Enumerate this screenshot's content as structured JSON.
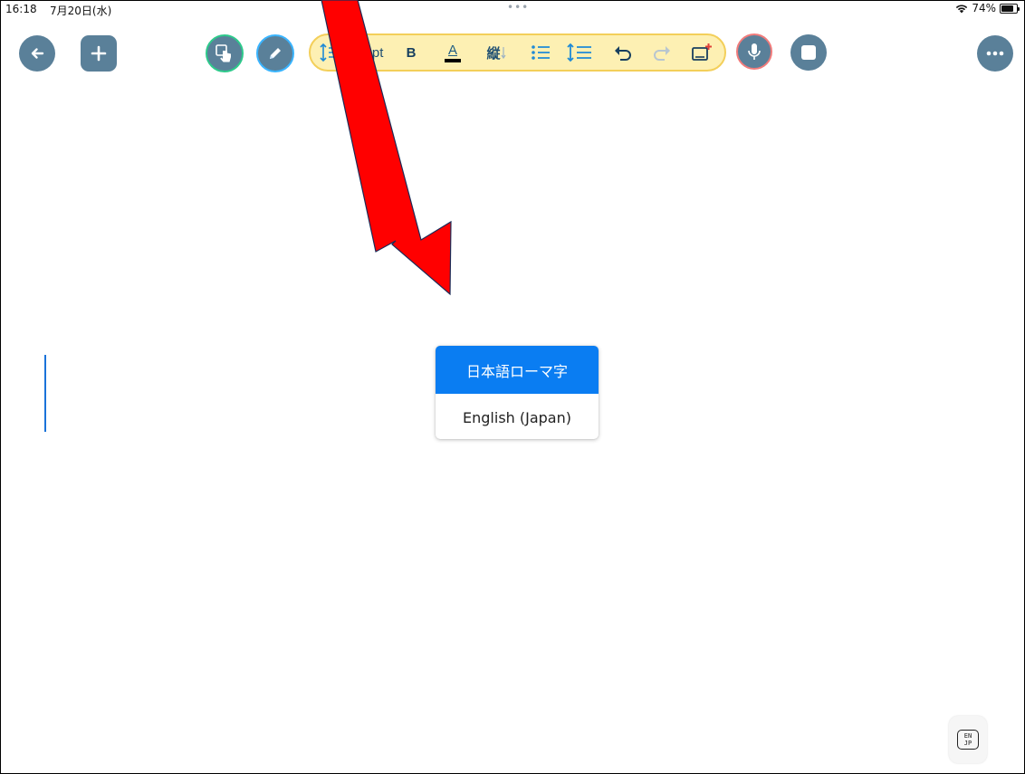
{
  "status_bar": {
    "time": "16:18",
    "date": "7月20日(水)",
    "dots": "•••",
    "battery_pct": "74%"
  },
  "toolbar": {
    "back_icon": "arrow-left-icon",
    "add_icon": "plus-icon",
    "touch_mode_icon": "hand-pointer-icon",
    "pen_mode_icon": "pencil-icon",
    "font_size": "0pt",
    "bold_label": "B",
    "font_color_label": "A",
    "vertical_text_label": "縦",
    "record_icon": "microphone-icon",
    "stop_icon": "stop-icon",
    "more_icon": "ellipsis-icon"
  },
  "language_menu": {
    "options": [
      {
        "label": "日本語ローマ字",
        "selected": true
      },
      {
        "label": "English (Japan)",
        "selected": false
      }
    ]
  },
  "keyboard_switch": {
    "top": "EN",
    "bottom": "JP"
  },
  "colors": {
    "toolbar_button": "#5a8099",
    "toolbar_pill_bg": "#fdf0b3",
    "toolbar_pill_border": "#f3cf5a",
    "selected_option": "#0a7df2",
    "annotation_arrow": "#ff0000"
  }
}
